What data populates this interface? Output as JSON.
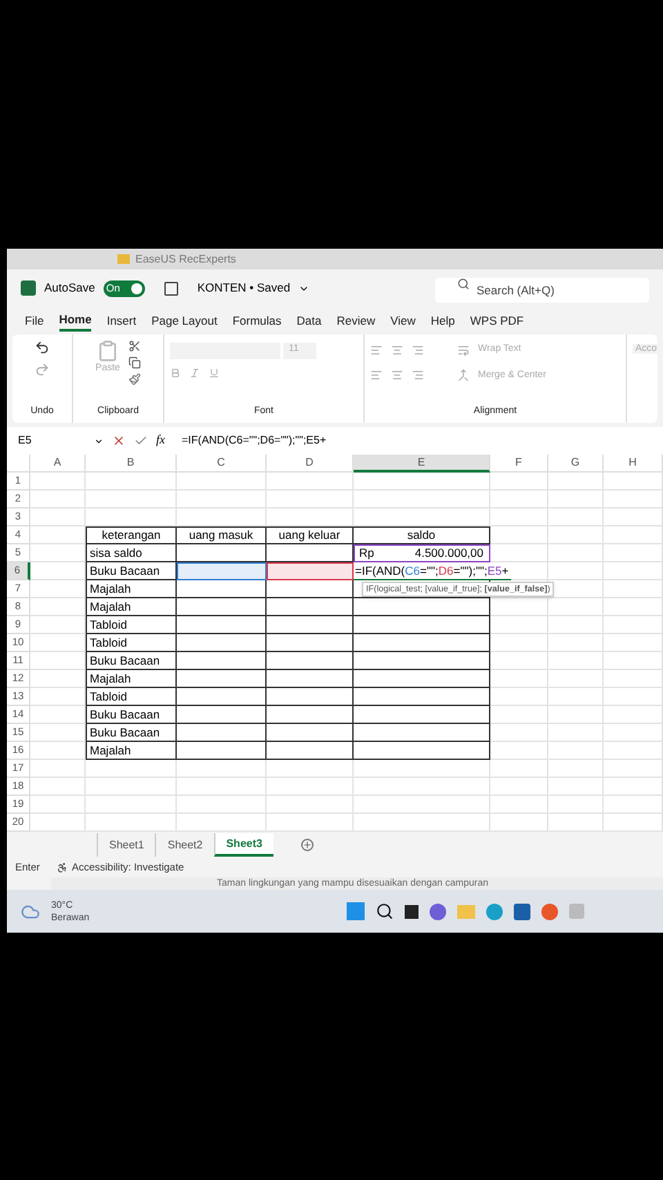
{
  "background_window": {
    "title": "EaseUS RecExperts"
  },
  "title_bar": {
    "autosave_label": "AutoSave",
    "autosave": {
      "label": "On",
      "on": true
    },
    "file_name": "KONTEN • Saved",
    "search": {
      "placeholder": "Search (Alt+Q)"
    }
  },
  "menu_tabs": [
    {
      "label": "File",
      "selected": false
    },
    {
      "label": "Home",
      "selected": true
    },
    {
      "label": "Insert",
      "selected": false
    },
    {
      "label": "Page Layout",
      "selected": false
    },
    {
      "label": "Formulas",
      "selected": false
    },
    {
      "label": "Data",
      "selected": false
    },
    {
      "label": "Review",
      "selected": false
    },
    {
      "label": "View",
      "selected": false
    },
    {
      "label": "Help",
      "selected": false
    },
    {
      "label": "WPS PDF",
      "selected": false
    }
  ],
  "ribbon": {
    "groups": [
      "Undo",
      "Clipboard",
      "Font",
      "Alignment"
    ],
    "paste_label": "Paste",
    "font_size": "11",
    "wrap_text": "Wrap Text",
    "merge_center": "Merge & Center",
    "number_format": "Acco"
  },
  "formula_bar": {
    "name_box": "E5",
    "function_label": "fx",
    "formula": "=IF(AND(C6=\"\";D6=\"\");\"\";E5+"
  },
  "sheet": {
    "columns": [
      {
        "label": "A",
        "selected": false
      },
      {
        "label": "B",
        "selected": false
      },
      {
        "label": "C",
        "selected": false
      },
      {
        "label": "D",
        "selected": false
      },
      {
        "label": "E",
        "selected": true
      },
      {
        "label": "F",
        "selected": false
      },
      {
        "label": "G",
        "selected": false
      },
      {
        "label": "H",
        "selected": false
      }
    ],
    "rows": [
      {
        "number": "1",
        "selected": false,
        "cells": []
      },
      {
        "number": "2",
        "selected": false,
        "cells": []
      },
      {
        "number": "3",
        "selected": false,
        "cells": []
      },
      {
        "number": "4",
        "selected": false,
        "cells": [
          {
            "kind": "text",
            "text": ""
          },
          {
            "kind": "header",
            "text": "keterangan"
          },
          {
            "kind": "header",
            "text": "uang masuk"
          },
          {
            "kind": "header",
            "text": "uang keluar"
          },
          {
            "kind": "header",
            "text": "saldo"
          }
        ]
      },
      {
        "number": "5",
        "selected": false,
        "cells": [
          {
            "kind": "text",
            "text": ""
          },
          {
            "kind": "text",
            "text": "sisa saldo"
          },
          {
            "kind": "text",
            "text": ""
          },
          {
            "kind": "text",
            "text": ""
          },
          {
            "kind": "currency",
            "prefix": "Rp",
            "text": "4.500.000,00",
            "color": "#8e44c4"
          }
        ]
      },
      {
        "number": "6",
        "selected": true,
        "cells": [
          {
            "kind": "text",
            "text": ""
          },
          {
            "kind": "text",
            "text": "Buku Bacaan"
          },
          {
            "kind": "text",
            "text": "",
            "color": "#2f7fd1"
          },
          {
            "kind": "text",
            "text": "",
            "color": "#d9374b"
          },
          {
            "kind": "formula",
            "segments": [
              {
                "text": "=IF(AND(",
                "color": "#000000"
              },
              {
                "text": "C6",
                "color": "#2f7fd1"
              },
              {
                "text": "=\"\";",
                "color": "#000000"
              },
              {
                "text": "D6",
                "color": "#d9374b"
              },
              {
                "text": "=\"\");\"\";",
                "color": "#000000"
              },
              {
                "text": "E5",
                "color": "#8e44c4"
              },
              {
                "text": "+",
                "color": "#000000"
              }
            ]
          }
        ]
      },
      {
        "number": "7",
        "selected": false,
        "cells": [
          {
            "kind": "text",
            "text": ""
          },
          {
            "kind": "text",
            "text": "Majalah"
          }
        ]
      },
      {
        "number": "8",
        "selected": false,
        "cells": [
          {
            "kind": "text",
            "text": ""
          },
          {
            "kind": "text",
            "text": "Majalah"
          }
        ]
      },
      {
        "number": "9",
        "selected": false,
        "cells": [
          {
            "kind": "text",
            "text": ""
          },
          {
            "kind": "text",
            "text": "Tabloid"
          }
        ]
      },
      {
        "number": "10",
        "selected": false,
        "cells": [
          {
            "kind": "text",
            "text": ""
          },
          {
            "kind": "text",
            "text": "Tabloid"
          }
        ]
      },
      {
        "number": "11",
        "selected": false,
        "cells": [
          {
            "kind": "text",
            "text": ""
          },
          {
            "kind": "text",
            "text": "Buku Bacaan"
          }
        ]
      },
      {
        "number": "12",
        "selected": false,
        "cells": [
          {
            "kind": "text",
            "text": ""
          },
          {
            "kind": "text",
            "text": "Majalah"
          }
        ]
      },
      {
        "number": "13",
        "selected": false,
        "cells": [
          {
            "kind": "text",
            "text": ""
          },
          {
            "kind": "text",
            "text": "Tabloid"
          }
        ]
      },
      {
        "number": "14",
        "selected": false,
        "cells": [
          {
            "kind": "text",
            "text": ""
          },
          {
            "kind": "text",
            "text": "Buku Bacaan"
          }
        ]
      },
      {
        "number": "15",
        "selected": false,
        "cells": [
          {
            "kind": "text",
            "text": ""
          },
          {
            "kind": "text",
            "text": "Buku Bacaan"
          }
        ]
      },
      {
        "number": "16",
        "selected": false,
        "cells": [
          {
            "kind": "text",
            "text": ""
          },
          {
            "kind": "text",
            "text": "Majalah"
          }
        ]
      },
      {
        "number": "17",
        "selected": false,
        "cells": []
      },
      {
        "number": "18",
        "selected": false,
        "cells": []
      },
      {
        "number": "19",
        "selected": false,
        "cells": []
      },
      {
        "number": "20",
        "selected": false,
        "cells": []
      }
    ],
    "tooltip": "IF(logical_test; [value_if_true]; **[value_if_false]**)"
  },
  "sheet_tabs": [
    {
      "label": "Sheet1",
      "selected": false
    },
    {
      "label": "Sheet2",
      "selected": false
    },
    {
      "label": "Sheet3",
      "selected": true
    }
  ],
  "status_bar": {
    "mode": "Enter",
    "accessibility": "Accessibility: Investigate"
  },
  "background_text": "Taman lingkungan yang mampu disesuaikan dengan campuran",
  "taskbar": {
    "temperature": "30°C",
    "weather": "Berawan"
  }
}
